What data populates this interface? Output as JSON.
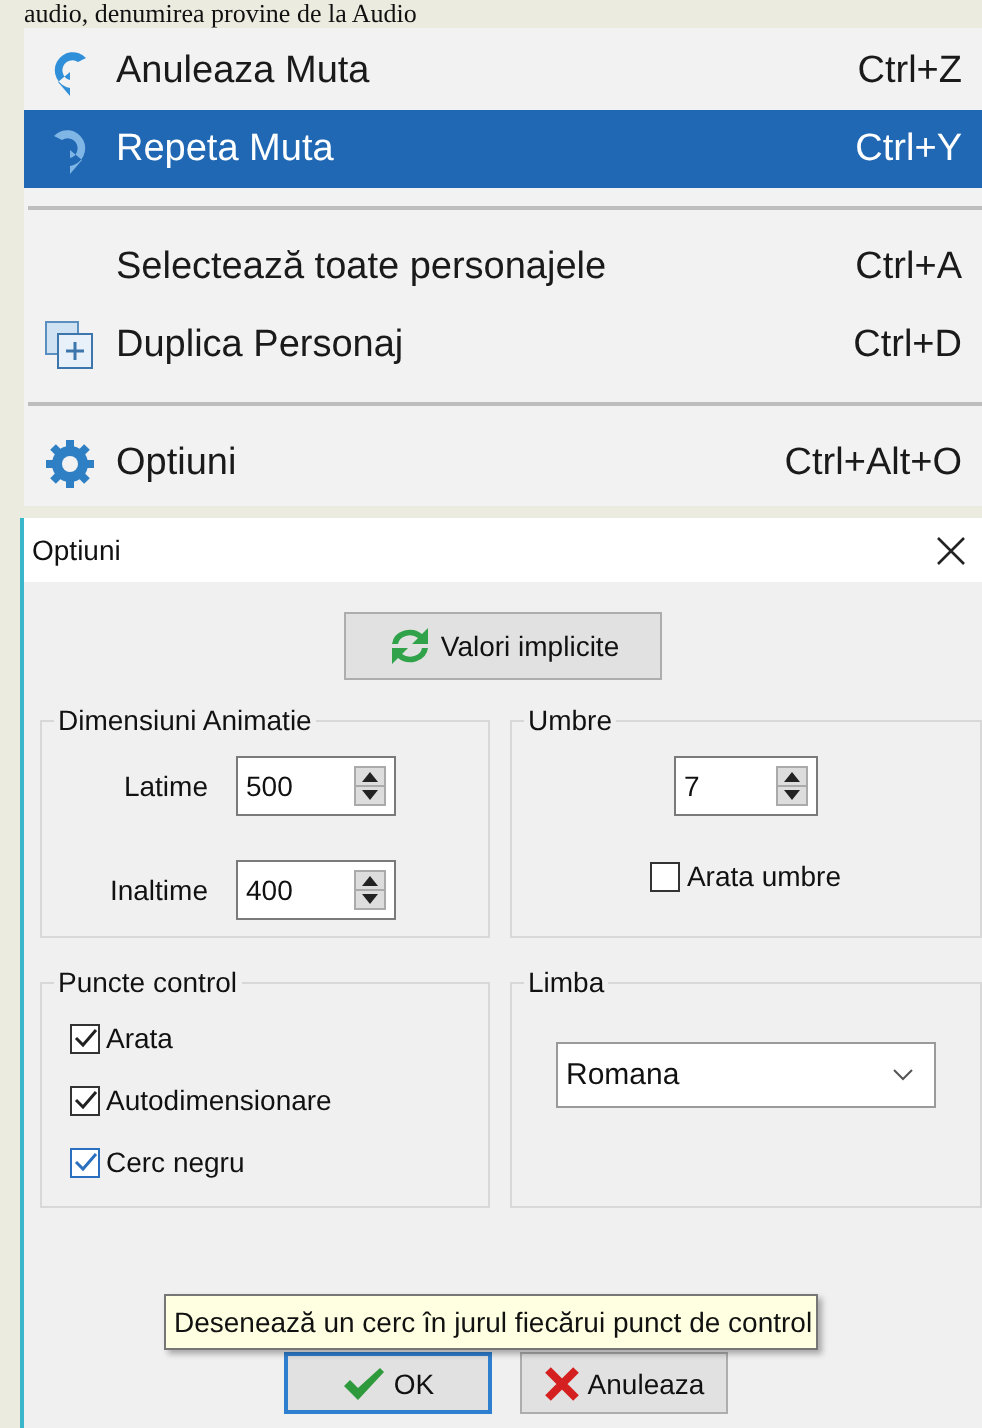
{
  "caption_fragment": "audio, denumirea provine de la Audio",
  "menu": {
    "items": [
      {
        "label": "Anuleaza Muta",
        "shortcut": "Ctrl+Z",
        "selected": false,
        "separator_before": false
      },
      {
        "label": "Repeta Muta",
        "shortcut": "Ctrl+Y",
        "selected": true,
        "separator_before": false
      },
      {
        "label": "Selectează toate personajele",
        "shortcut": "Ctrl+A",
        "selected": false,
        "separator_before": true
      },
      {
        "label": "Duplica Personaj",
        "shortcut": "Ctrl+D",
        "selected": false,
        "separator_before": false
      },
      {
        "label": "Optiuni",
        "shortcut": "Ctrl+Alt+O",
        "selected": false,
        "separator_before": true
      }
    ]
  },
  "dialog": {
    "title": "Optiuni",
    "defaults_button": "Valori implicite",
    "dimensions": {
      "title": "Dimensiuni Animatie",
      "fields": [
        {
          "label": "Latime",
          "value": "500"
        },
        {
          "label": "Inaltime",
          "value": "400"
        }
      ]
    },
    "shadows": {
      "title": "Umbre",
      "value": "7",
      "checkbox": {
        "label": "Arata umbre",
        "checked": false
      }
    },
    "control_points": {
      "title": "Puncte control",
      "checkboxes": [
        {
          "label": "Arata",
          "checked": true,
          "hovered": false
        },
        {
          "label": "Autodimensionare",
          "checked": true,
          "hovered": false
        },
        {
          "label": "Cerc negru",
          "checked": true,
          "hovered": true
        }
      ]
    },
    "language": {
      "title": "Limba",
      "value": "Romana"
    },
    "tooltip": "Desenează un cerc în jurul fiecărui punct de control",
    "buttons": [
      {
        "label": "OK",
        "kind": "ok",
        "default": true
      },
      {
        "label": "Anuleaza",
        "kind": "cancel",
        "default": false
      }
    ]
  }
}
